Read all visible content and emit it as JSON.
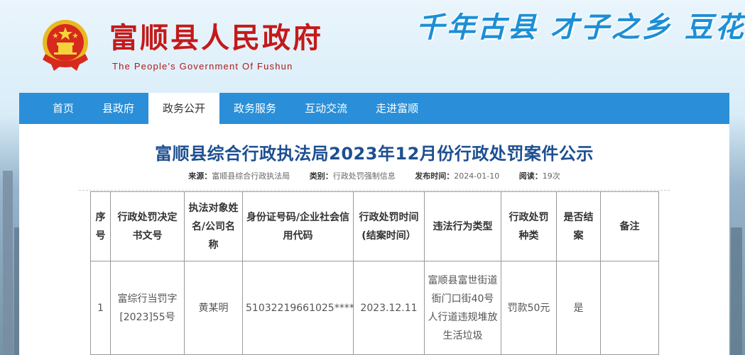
{
  "header": {
    "title": "富顺县人民政府",
    "subtitle": "The People's Government Of Fushun",
    "slogan": "千年古县 才子之乡 豆花"
  },
  "nav": {
    "items": [
      {
        "label": "首页"
      },
      {
        "label": "县政府"
      },
      {
        "label": "政务公开"
      },
      {
        "label": "政务服务"
      },
      {
        "label": "互动交流"
      },
      {
        "label": "走进富顺"
      }
    ]
  },
  "article": {
    "title": "富顺县综合行政执法局2023年12月份行政处罚案件公示",
    "meta": {
      "source_label": "来源：",
      "source": "富顺县综合行政执法局",
      "category_label": "类别：",
      "category": "行政处罚强制信息",
      "date_label": "发布时间：",
      "date": "2024-01-10",
      "views_label": "阅读：",
      "views": "19次"
    }
  },
  "table": {
    "headers": [
      "序号",
      "行政处罚决定书文号",
      "执法对象姓名/公司名称",
      "身份证号码/企业社会信用代码",
      "行政处罚时间(结案时间）",
      "违法行为类型",
      "行政处罚种类",
      "是否结案",
      "备注"
    ],
    "rows": [
      [
        "1",
        "富综行当罚字[2023]55号",
        "黄某明",
        "51032219661025****",
        "2023.12.11",
        "富顺县富世街道衙门口街40号人行道违规堆放生活垃圾",
        "罚款50元",
        "是",
        ""
      ]
    ]
  },
  "colors": {
    "nav_bg": "#2a8fd8",
    "title_red": "#c41a1a",
    "article_title": "#1d4f91",
    "slogan": "#1c8fd6"
  }
}
